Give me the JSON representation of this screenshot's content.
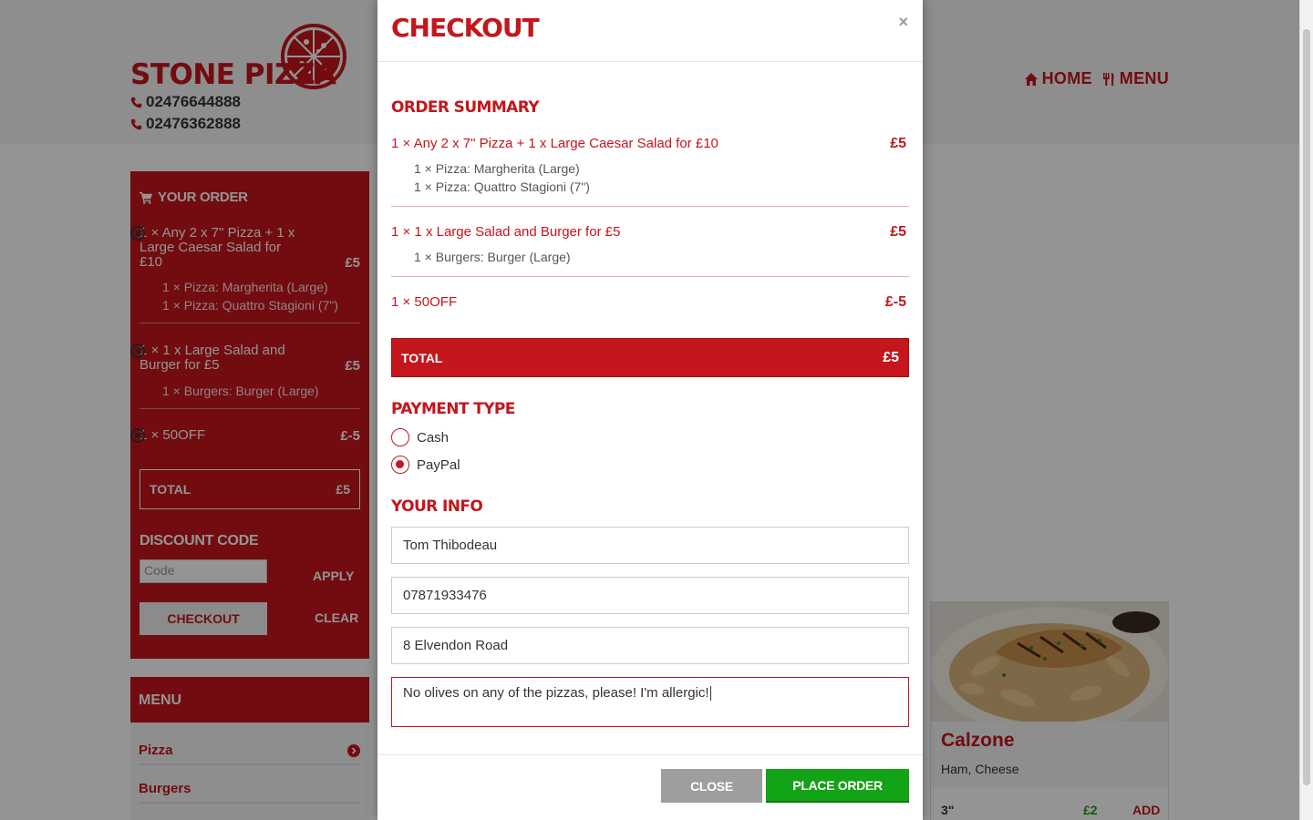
{
  "site": {
    "logo_text": "STONE PIZZA",
    "phones": [
      "02476644888",
      "02476362888"
    ],
    "nav": [
      {
        "label": "HOME",
        "icon": "home-icon"
      },
      {
        "label": "MENU",
        "icon": "cutlery-icon"
      }
    ]
  },
  "sidebar_order": {
    "title": "YOUR ORDER",
    "items": [
      {
        "name": "1 × Any 2 x 7\" Pizza + 1 x Large Caesar Salad for £10",
        "price": "£5",
        "subs": [
          "1 × Pizza: Margherita (Large)",
          "1 × Pizza: Quattro Stagioni (7\")"
        ]
      },
      {
        "name": "1 × 1 x Large Salad and Burger for £5",
        "price": "£5",
        "subs": [
          "1 × Burgers: Burger (Large)"
        ]
      },
      {
        "name": "1 × 50OFF",
        "price": "£-5",
        "subs": []
      }
    ],
    "total_label": "TOTAL",
    "total_value": "£5",
    "discount_title": "DISCOUNT CODE",
    "code_placeholder": "Code",
    "apply_label": "APPLY",
    "checkout_label": "CHECKOUT",
    "clear_label": "CLEAR"
  },
  "menu_box": {
    "title": "MENU",
    "links": [
      "Pizza",
      "Burgers"
    ]
  },
  "product": {
    "name": "Calzone",
    "description": "Ham, Cheese",
    "size": "3\"",
    "price": "£2",
    "add_label": "ADD"
  },
  "modal": {
    "title": "CHECKOUT",
    "close_symbol": "×",
    "summary_title": "ORDER SUMMARY",
    "items": [
      {
        "name": "1 × Any 2 x 7\" Pizza + 1 x Large Caesar Salad for £10",
        "price": "£5",
        "subs": [
          "1 × Pizza: Margherita (Large)",
          "1 × Pizza: Quattro Stagioni (7\")"
        ]
      },
      {
        "name": "1 × 1 x Large Salad and Burger for £5",
        "price": "£5",
        "subs": [
          "1 × Burgers: Burger (Large)"
        ]
      },
      {
        "name": "1 × 50OFF",
        "price": "£-5",
        "subs": []
      }
    ],
    "total_label": "TOTAL",
    "total_value": "£5",
    "payment_title": "PAYMENT TYPE",
    "payment_options": [
      {
        "label": "Cash",
        "checked": false
      },
      {
        "label": "PayPal",
        "checked": true
      }
    ],
    "info_title": "YOUR INFO",
    "fields": {
      "name": "Tom Thibodeau",
      "phone": "07871933476",
      "address": "8 Elvendon Road",
      "notes": "No olives on any of the pizzas, please! I'm allergic!"
    },
    "close_button": "CLOSE",
    "place_order_button": "PLACE ORDER"
  },
  "colors": {
    "brand_red": "#c4161c",
    "place_order_green": "#13a316",
    "close_grey": "#9e9e9e"
  }
}
